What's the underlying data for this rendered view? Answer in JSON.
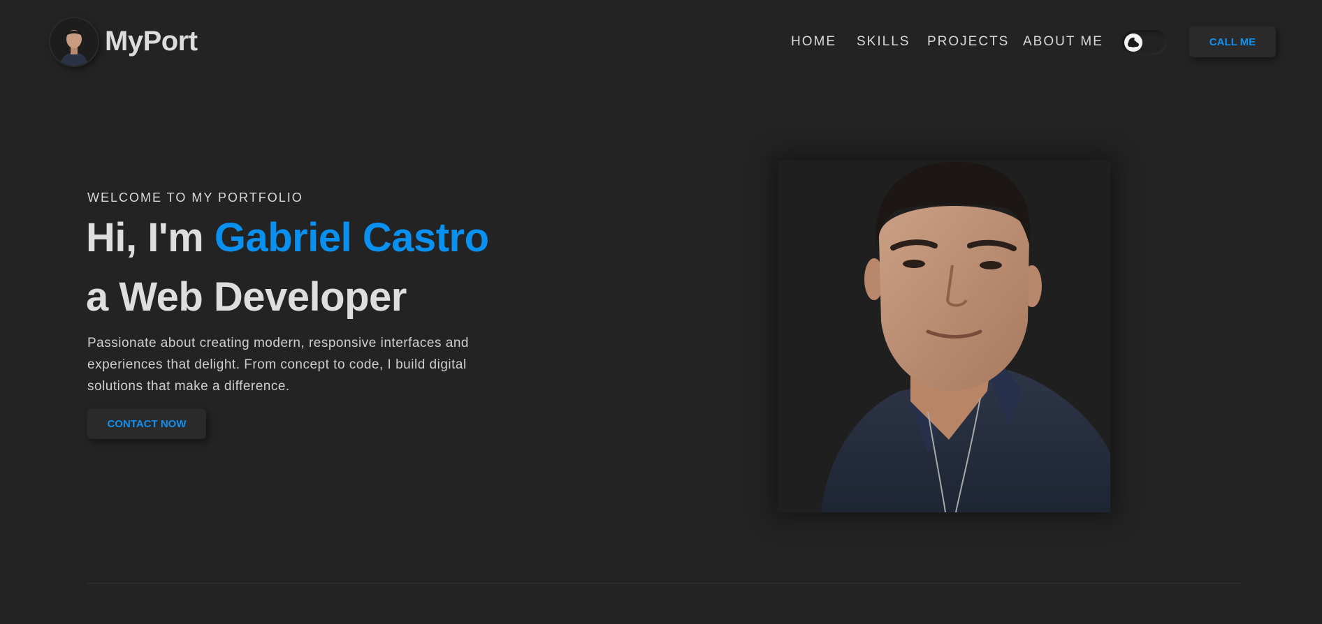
{
  "header": {
    "logo_title": "MyPort",
    "nav": [
      "HOME",
      "SKILLS",
      "PROJECTS",
      "ABOUT ME"
    ],
    "theme_toggle_icon": "moon-cloud-icon",
    "call_button": "CALL ME"
  },
  "hero": {
    "kicker": "WELCOME TO MY PORTFOLIO",
    "greeting": "Hi, I'm",
    "name": "Gabriel Castro",
    "role_line": "a Web Developer",
    "description": "Passionate about creating modern, responsive interfaces and experiences that delight. From concept to code, I build digital solutions that make a difference.",
    "contact_button": "CONTACT NOW"
  },
  "colors": {
    "background": "#232323",
    "accent": "#0a91f0",
    "text": "#d8d8d8"
  }
}
